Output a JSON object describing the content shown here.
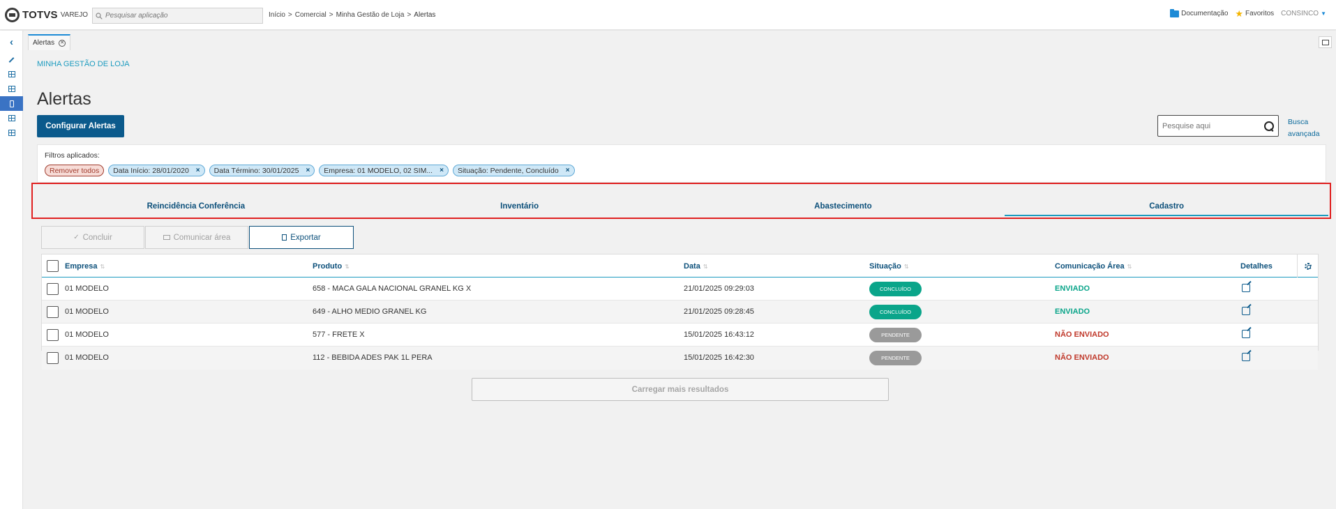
{
  "header": {
    "brand": "TOTVS",
    "brand_sub": "VAREJO",
    "search_placeholder": "Pesquisar aplicação",
    "breadcrumb": [
      "Início",
      "Comercial",
      "Minha Gestão de Loja",
      "Alertas"
    ],
    "breadcrumb_sep": ">",
    "documentation": "Documentação",
    "favorites": "Favoritos",
    "user": "CONSINCO"
  },
  "sidebar": {
    "items": [
      "back-icon",
      "pen-icon",
      "grid-icon",
      "grid-icon",
      "phone-icon",
      "grid-icon",
      "grid-icon"
    ],
    "active_index": 4
  },
  "tabs": {
    "open_tab": "Alertas"
  },
  "page": {
    "module": "MINHA GESTÃO DE LOJA",
    "title": "Alertas",
    "config_button": "Configurar Alertas",
    "search_placeholder": "Pesquise aqui",
    "advanced_search_line1": "Busca",
    "advanced_search_line2": "avançada"
  },
  "filters": {
    "label": "Filtros aplicados:",
    "remove_all": "Remover todos",
    "chips": [
      "Data Início: 28/01/2020",
      "Data Término: 30/01/2025",
      "Empresa: 01 MODELO, 02 SIM...",
      "Situação: Pendente, Concluído"
    ],
    "chip_close": "×"
  },
  "category_tabs": {
    "items": [
      "Reincidência Conferência",
      "Inventário",
      "Abastecimento",
      "Cadastro"
    ],
    "active_index": 3
  },
  "actions": {
    "conclude": "Concluir",
    "communicate": "Comunicar área",
    "export": "Exportar"
  },
  "table": {
    "columns": [
      "Empresa",
      "Produto",
      "Data",
      "Situação",
      "Comunicação Área",
      "Detalhes"
    ],
    "rows": [
      {
        "empresa": "01 MODELO",
        "produto": "658 - MACA GALA NACIONAL GRANEL KG X",
        "data": "21/01/2025 09:29:03",
        "situacao": "CONCLUÍDO",
        "comunicacao": "ENVIADO"
      },
      {
        "empresa": "01 MODELO",
        "produto": "649 - ALHO MEDIO GRANEL KG",
        "data": "21/01/2025 09:28:45",
        "situacao": "CONCLUÍDO",
        "comunicacao": "ENVIADO"
      },
      {
        "empresa": "01 MODELO",
        "produto": "577 - FRETE X",
        "data": "15/01/2025 16:43:12",
        "situacao": "PENDENTE",
        "comunicacao": "NÃO ENVIADO"
      },
      {
        "empresa": "01 MODELO",
        "produto": "112 - BEBIDA ADES PAK 1L PERA",
        "data": "15/01/2025 16:42:30",
        "situacao": "PENDENTE",
        "comunicacao": "NÃO ENVIADO"
      }
    ]
  },
  "load_more": "Carregar mais resultados",
  "colors": {
    "primary": "#0b5a8c",
    "accent": "#1c9bbf",
    "success": "#0aa58a",
    "danger": "#c0392b",
    "highlight_border": "#e02020"
  }
}
